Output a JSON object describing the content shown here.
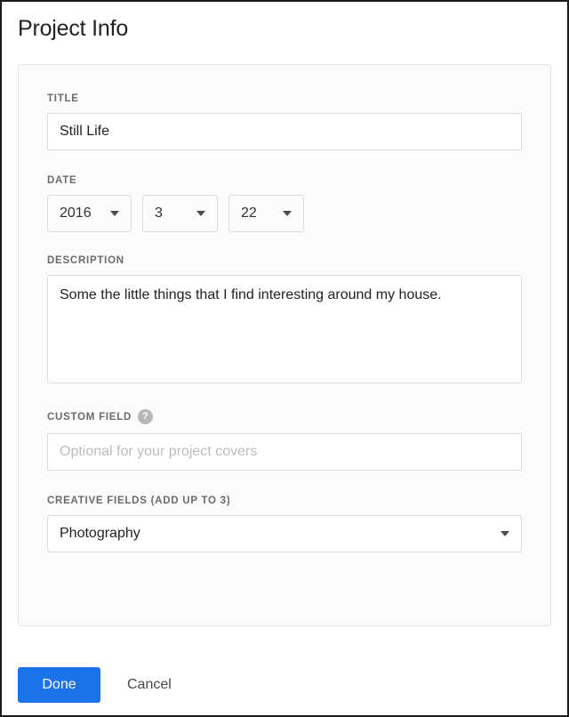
{
  "page": {
    "title": "Project Info"
  },
  "form": {
    "title_field": {
      "label": "TITLE",
      "value": "Still Life"
    },
    "date_field": {
      "label": "DATE",
      "year": "2016",
      "month": "3",
      "day": "22"
    },
    "description_field": {
      "label": "DESCRIPTION",
      "value": "Some the little things that I find interesting around my house."
    },
    "custom_field": {
      "label": "CUSTOM FIELD",
      "help_icon": "question-mark-icon",
      "help_glyph": "?",
      "placeholder": "Optional for your project covers",
      "value": ""
    },
    "creative_fields": {
      "label": "CREATIVE FIELDS (ADD UP TO 3)",
      "selected": "Photography"
    }
  },
  "footer": {
    "done_label": "Done",
    "cancel_label": "Cancel"
  },
  "colors": {
    "accent": "#1a73e8",
    "label": "#6b6b6b",
    "border": "#dcdcdc",
    "card_bg": "#fbfbfb",
    "help_icon_bg": "#b8b8b8"
  }
}
